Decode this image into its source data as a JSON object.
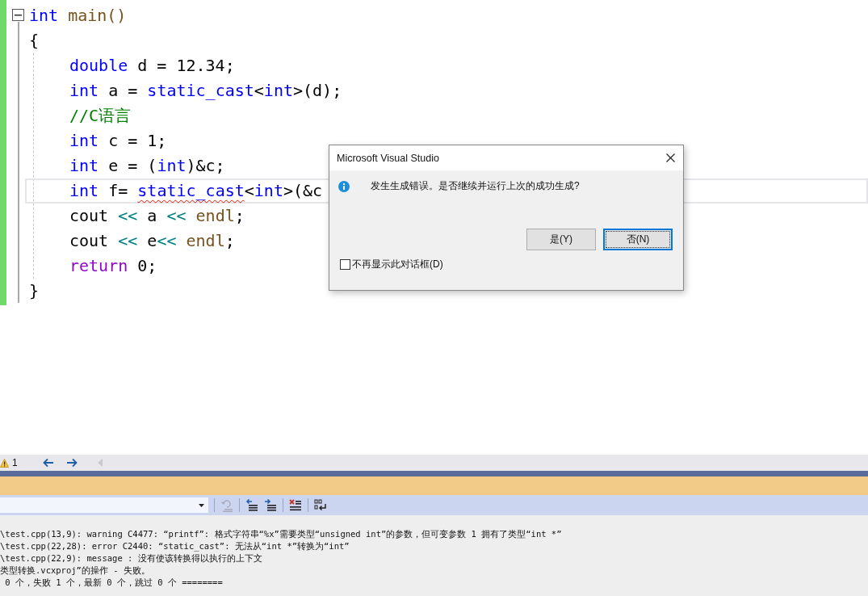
{
  "editor": {
    "fold_expanded": true,
    "header": [
      {
        "text": "int",
        "kind": "keyword"
      },
      {
        "text": " main()",
        "kind": "function"
      }
    ],
    "open_brace": "{",
    "body": [
      {
        "current": false,
        "tokens": [
          {
            "text": "double",
            "kind": "keyword"
          },
          {
            "text": " d = 12.34;",
            "kind": "plain"
          }
        ]
      },
      {
        "current": false,
        "tokens": [
          {
            "text": "int",
            "kind": "keyword"
          },
          {
            "text": " a = ",
            "kind": "plain"
          },
          {
            "text": "static_cast",
            "kind": "keyword"
          },
          {
            "text": "<",
            "kind": "plain"
          },
          {
            "text": "int",
            "kind": "keyword"
          },
          {
            "text": ">(d);",
            "kind": "plain"
          }
        ]
      },
      {
        "current": false,
        "tokens": [
          {
            "text": "//C语言",
            "kind": "comment"
          }
        ]
      },
      {
        "current": false,
        "tokens": [
          {
            "text": "int",
            "kind": "keyword"
          },
          {
            "text": " c = 1;",
            "kind": "plain"
          }
        ]
      },
      {
        "current": false,
        "tokens": [
          {
            "text": "int",
            "kind": "keyword"
          },
          {
            "text": " e = (",
            "kind": "plain"
          },
          {
            "text": "int",
            "kind": "keyword"
          },
          {
            "text": ")&c;",
            "kind": "plain"
          }
        ]
      },
      {
        "current": true,
        "tokens": [
          {
            "text": "int",
            "kind": "keyword"
          },
          {
            "text": " f= ",
            "kind": "plain"
          },
          {
            "text": "static_cast",
            "kind": "keyword",
            "error": true
          },
          {
            "text": "<",
            "kind": "plain"
          },
          {
            "text": "int",
            "kind": "keyword"
          },
          {
            "text": ">(&c",
            "kind": "plain"
          }
        ]
      },
      {
        "current": false,
        "tokens": [
          {
            "text": "cout",
            "kind": "plain"
          },
          {
            "text": " << ",
            "kind": "operator"
          },
          {
            "text": "a",
            "kind": "plain"
          },
          {
            "text": " << ",
            "kind": "operator"
          },
          {
            "text": "endl",
            "kind": "function"
          },
          {
            "text": ";",
            "kind": "plain"
          }
        ]
      },
      {
        "current": false,
        "tokens": [
          {
            "text": "cout",
            "kind": "plain"
          },
          {
            "text": " << ",
            "kind": "operator"
          },
          {
            "text": "e",
            "kind": "plain"
          },
          {
            "text": "<< ",
            "kind": "operator"
          },
          {
            "text": "endl",
            "kind": "function"
          },
          {
            "text": ";",
            "kind": "plain"
          }
        ]
      },
      {
        "current": false,
        "tokens": [
          {
            "text": "return",
            "kind": "control"
          },
          {
            "text": " 0;",
            "kind": "plain"
          }
        ]
      }
    ],
    "close_brace": "}"
  },
  "dialog": {
    "title": "Microsoft Visual Studio",
    "message": "发生生成错误。是否继续并运行上次的成功生成?",
    "buttons": [
      {
        "label": "是(Y)",
        "selected": false
      },
      {
        "label": "否(N)",
        "selected": true
      }
    ],
    "checkbox": {
      "label": "不再显示此对话框(D)",
      "checked": false
    }
  },
  "nav_bar": {
    "warning_count": "1"
  },
  "output": {
    "lines": [
      "\\test.cpp(13,9): warning C4477: “printf”: 格式字符串“%x”需要类型“unsigned int”的参数，但可变参数 1 拥有了类型“int *”",
      "\\test.cpp(22,28): error C2440: “static_cast”: 无法从“int *”转换为“int”",
      "\\test.cpp(22,9): message : 没有使该转换得以执行的上下文",
      "类型转换.vcxproj”的操作 - 失败。",
      " 0 个，失败 1 个，最新 0 个，跳过 0 个 ========"
    ]
  }
}
